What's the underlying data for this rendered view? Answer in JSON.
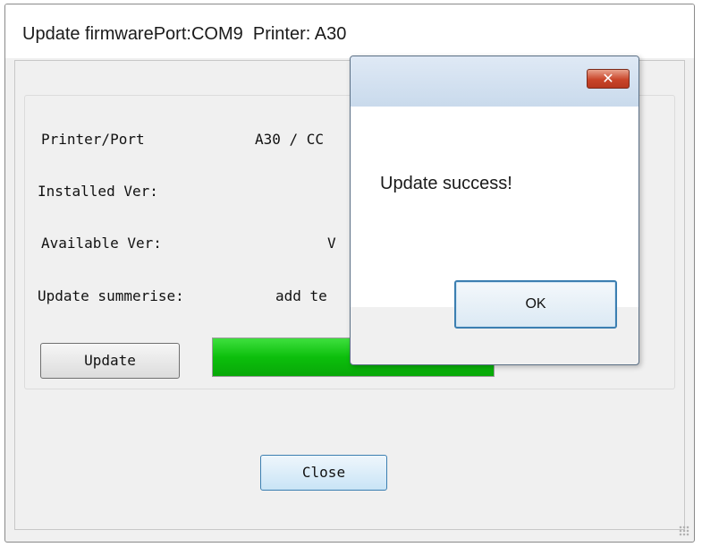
{
  "window": {
    "title": "Update firmwarePort:COM9  Printer: A30"
  },
  "info": {
    "printer_port_label": "Printer/Port",
    "printer_port_value": "A30 / CC",
    "installed_ver_label": "Installed Ver:",
    "available_ver_label": "Available Ver:",
    "available_ver_value": "V",
    "update_summary_label": "Update summerise:",
    "update_summary_value": "add te"
  },
  "buttons": {
    "update": "Update",
    "close": "Close"
  },
  "progress": {
    "value": 1.0
  },
  "dialog": {
    "close_glyph": "✕",
    "message": "Update success!",
    "ok": "OK"
  }
}
